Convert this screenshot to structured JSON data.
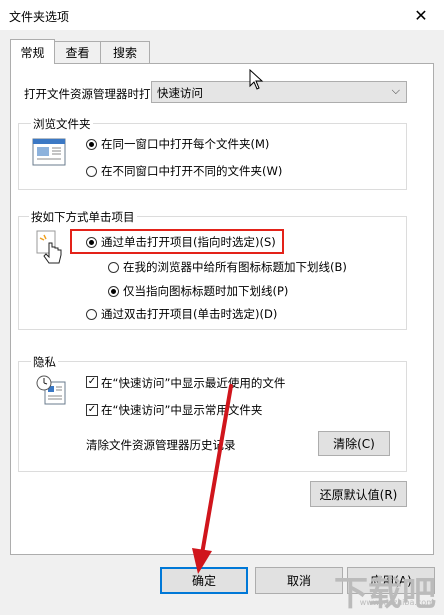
{
  "window": {
    "title": "文件夹选项"
  },
  "tabs": [
    {
      "label": "常规",
      "active": true
    },
    {
      "label": "查看",
      "active": false
    },
    {
      "label": "搜索",
      "active": false
    }
  ],
  "open_explorer": {
    "label": "打开文件资源管理器时打",
    "value": "快速访问"
  },
  "browse": {
    "title": "浏览文件夹",
    "options": [
      {
        "label": "在同一窗口中打开每个文件夹(M)",
        "checked": true
      },
      {
        "label": "在不同窗口中打开不同的文件夹(W)",
        "checked": false
      }
    ]
  },
  "click": {
    "title": "按如下方式单击项目",
    "single": {
      "label": "通过单击打开项目(指向时选定)(S)",
      "checked": true
    },
    "sub": [
      {
        "label": "在我的浏览器中给所有图标标题加下划线(B)",
        "checked": false
      },
      {
        "label": "仅当指向图标标题时加下划线(P)",
        "checked": true
      }
    ],
    "double": {
      "label": "通过双击打开项目(单击时选定)(D)",
      "checked": false
    }
  },
  "privacy": {
    "title": "隐私",
    "checks": [
      {
        "label": "在“快速访问”中显示最近使用的文件",
        "checked": true
      },
      {
        "label": "在“快速访问”中显示常用文件夹",
        "checked": true
      }
    ],
    "clear_label": "清除文件资源管理器历史记录",
    "clear_button": "清除(C)"
  },
  "restore_button": "还原默认值(R)",
  "footer": {
    "ok": "确定",
    "cancel": "取消",
    "apply": "应用(A)"
  },
  "watermark": {
    "logo": "下载吧",
    "url": "www.xiazaiba.com"
  },
  "colors": {
    "highlight": "#e32219",
    "arrow": "#d0151c"
  }
}
